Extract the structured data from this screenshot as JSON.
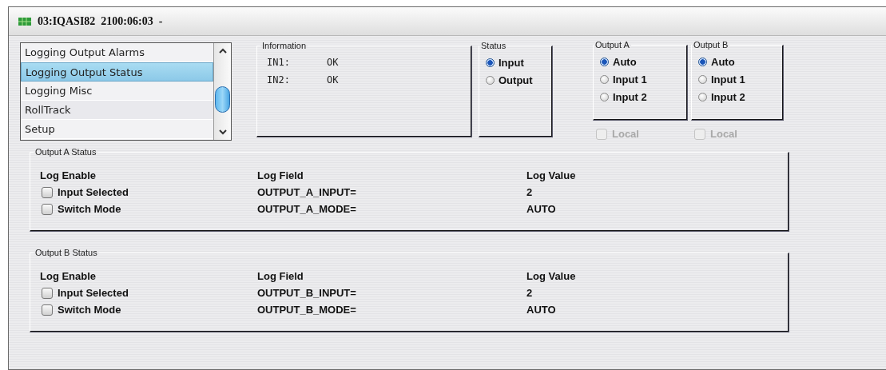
{
  "window": {
    "title": "03:IQASI82  2100:06:03  -"
  },
  "list": {
    "items": [
      {
        "label": "Logging Output Alarms",
        "selected": false
      },
      {
        "label": "Logging Output Status",
        "selected": true
      },
      {
        "label": "Logging Misc",
        "selected": false
      },
      {
        "label": "RollTrack",
        "selected": false
      },
      {
        "label": "Setup",
        "selected": false
      }
    ]
  },
  "information": {
    "title": "Information",
    "rows": [
      {
        "name": "IN1:",
        "value": "OK"
      },
      {
        "name": "IN2:",
        "value": "OK"
      }
    ]
  },
  "status": {
    "title": "Status",
    "options": [
      {
        "label": "Input",
        "selected": true
      },
      {
        "label": "Output",
        "selected": false
      }
    ]
  },
  "outputs": [
    {
      "title": "Output A",
      "options": [
        {
          "label": "Auto",
          "selected": true
        },
        {
          "label": "Input 1",
          "selected": false
        },
        {
          "label": "Input 2",
          "selected": false
        }
      ],
      "local": {
        "label": "Local",
        "checked": false,
        "disabled": true
      }
    },
    {
      "title": "Output B",
      "options": [
        {
          "label": "Auto",
          "selected": true
        },
        {
          "label": "Input 1",
          "selected": false
        },
        {
          "label": "Input 2",
          "selected": false
        }
      ],
      "local": {
        "label": "Local",
        "checked": false,
        "disabled": true
      }
    }
  ],
  "sections": [
    {
      "title": "Output A Status",
      "columns": [
        "Log Enable",
        "Log Field",
        "Log Value"
      ],
      "rows": [
        {
          "label": "Input Selected",
          "checked": false,
          "field": "OUTPUT_A_INPUT=",
          "value": "2"
        },
        {
          "label": "Switch Mode",
          "checked": false,
          "field": "OUTPUT_A_MODE=",
          "value": "AUTO"
        }
      ]
    },
    {
      "title": "Output B Status",
      "columns": [
        "Log Enable",
        "Log Field",
        "Log Value"
      ],
      "rows": [
        {
          "label": "Input Selected",
          "checked": false,
          "field": "OUTPUT_B_INPUT=",
          "value": "2"
        },
        {
          "label": "Switch Mode",
          "checked": false,
          "field": "OUTPUT_B_MODE=",
          "value": "AUTO"
        }
      ]
    }
  ]
}
